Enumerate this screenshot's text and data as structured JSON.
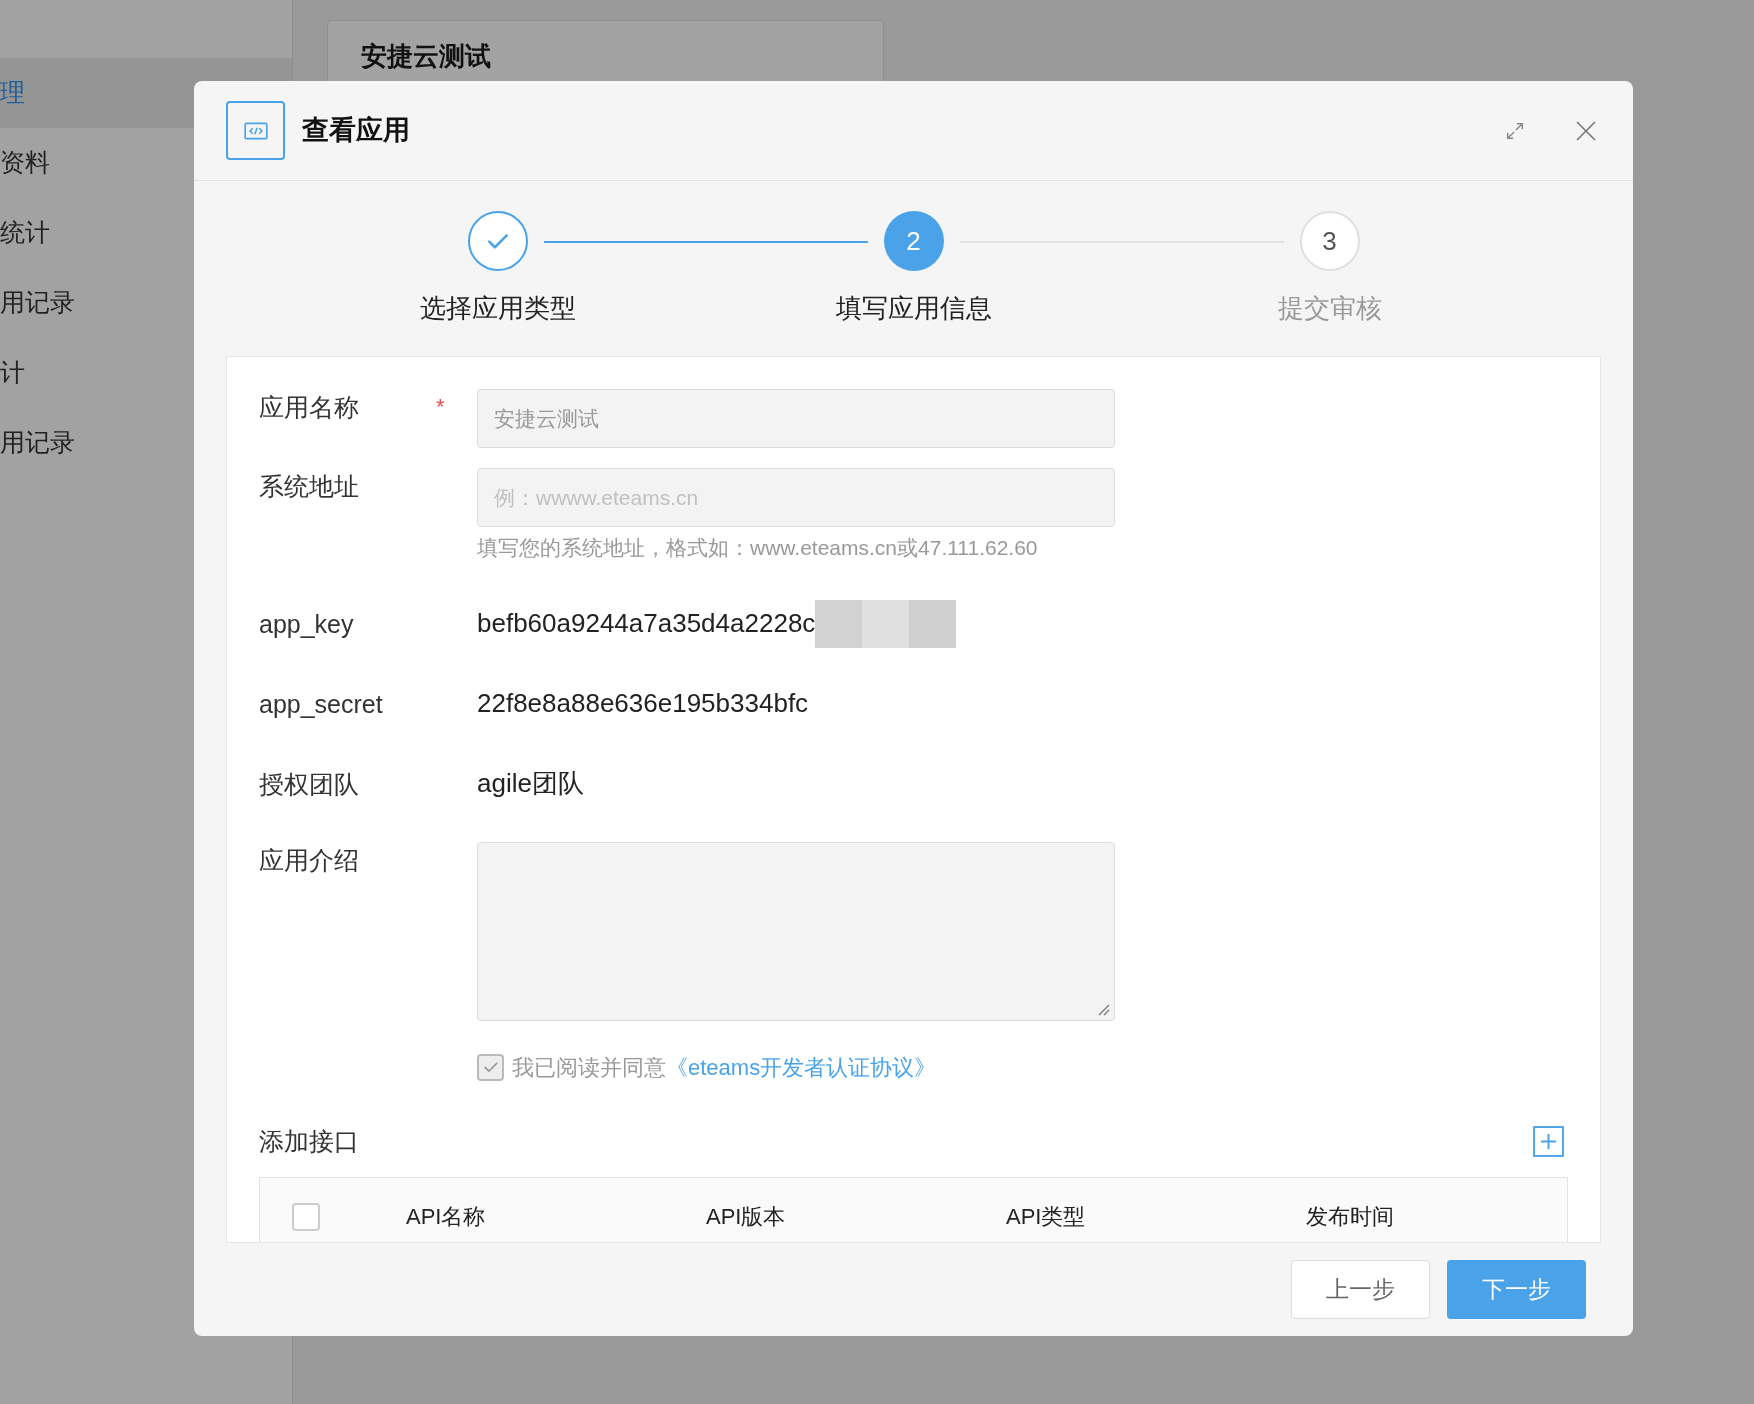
{
  "background": {
    "sidebar_items": [
      {
        "label": "理",
        "selected": true
      },
      {
        "label": "资料",
        "selected": false
      },
      {
        "label": "统计",
        "selected": false
      },
      {
        "label": "用记录",
        "selected": false
      },
      {
        "label": "计",
        "selected": false
      },
      {
        "label": "用记录",
        "selected": false
      }
    ],
    "card_title": "安捷云测试"
  },
  "dialog": {
    "title": "查看应用",
    "steps": [
      {
        "label": "选择应用类型",
        "completed": true,
        "selected": false
      },
      {
        "number": "2",
        "label": "填写应用信息",
        "completed": false,
        "selected": true
      },
      {
        "number": "3",
        "label": "提交审核",
        "completed": false,
        "selected": false
      }
    ],
    "fields": [
      {
        "kind": "input",
        "label": "应用名称",
        "required_mark": "*",
        "value": "安捷云测试"
      },
      {
        "kind": "input",
        "label": "系统地址",
        "placeholder": "例：wwww.eteams.cn",
        "hint": "填写您的系统地址，格式如：www.eteams.cn或47.111.62.60"
      },
      {
        "kind": "text",
        "label": "app_key",
        "value": "befb60a9244a7a35d4a2228c",
        "redacted": true
      },
      {
        "kind": "text",
        "label": "app_secret",
        "value": "22f8e8a88e636e195b334bfc"
      },
      {
        "kind": "text",
        "label": "授权团队",
        "value": "agile团队"
      },
      {
        "kind": "textarea",
        "label": "应用介绍"
      }
    ],
    "agreement": {
      "checked": true,
      "disabled": true,
      "text": "我已阅读并同意",
      "link": "《eteams开发者认证协议》"
    },
    "api_section": {
      "title": "添加接口",
      "columns": [
        "API名称",
        "API版本",
        "API类型",
        "发布时间"
      ],
      "select_all_checked": false
    },
    "buttons": [
      {
        "label": "上一步",
        "kind": "secondary"
      },
      {
        "label": "下一步",
        "kind": "primary"
      }
    ]
  }
}
